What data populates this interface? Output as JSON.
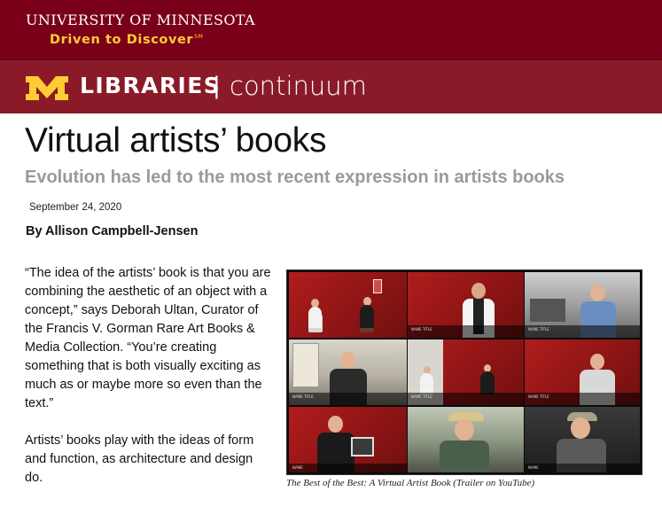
{
  "header": {
    "university": "University of Minnesota",
    "tagline": "Driven to Discover",
    "tagline_mark": "SM",
    "libraries": "LIBRARIES",
    "separator": "|",
    "section": "continuum",
    "brand_color": "#7a0019",
    "accent_color": "#ffcc33"
  },
  "article": {
    "title": "Virtual artists’ books",
    "subtitle": "Evolution has led to the most recent expression in artists books",
    "date": "September 24, 2020",
    "byline": "By Allison Campbell-Jensen",
    "paragraphs": [
      "“The idea of the artists’ book is that you are combining the aesthetic of an object with a concept,” says Deborah Ultan, Curator of the Francis V. Gorman Rare Art Books & Media Collection. “You’re creating something that is both visually exciting as much as or maybe more so even than the text.”",
      "Artists’ books play with the ideas of form and function, as architecture and design do."
    ]
  },
  "figure": {
    "caption": "The Best of the Best: A Virtual Artist Book (Trailer on YouTube)",
    "icon": "video-collage-image"
  }
}
